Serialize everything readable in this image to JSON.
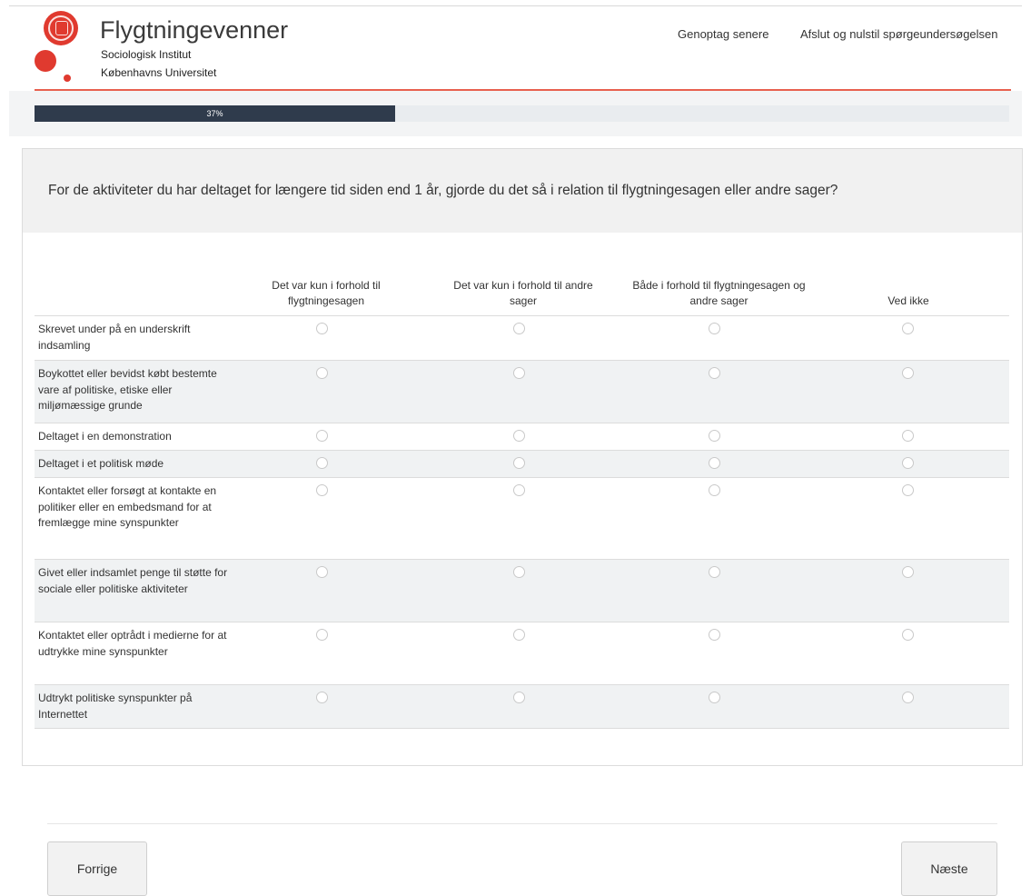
{
  "header": {
    "brand": "Flygtningevenner",
    "institute": "Sociologisk Institut",
    "university": "Københavns Universitet",
    "resume_link": "Genoptag senere",
    "exit_link": "Afslut og nulstil spørgeundersøgelsen"
  },
  "progress": {
    "value": 0.37,
    "label": "37%"
  },
  "question": {
    "text": "For de aktiviteter du har deltaget for længere tid siden end 1 år, gjorde du det så i relation til flygtningesagen eller andre sager?",
    "columns": [
      "Det var kun i forhold til flygtningesagen",
      "Det var kun i forhold til andre sager",
      "Både i forhold til flygtningesagen og andre sager",
      "Ved ikke"
    ],
    "rows": [
      "Skrevet under på en underskrift indsamling",
      "Boykottet eller bevidst købt bestemte vare af politiske, etiske eller miljømæssige grunde",
      "Deltaget i en demonstration",
      "Deltaget i et politisk møde",
      "Kontaktet eller forsøgt at kontakte en politiker eller en embedsmand for at fremlægge mine synspunkter",
      "Givet eller indsamlet penge til støtte for sociale eller politiske aktiviteter",
      "Kontaktet eller optrådt i medierne for at udtrykke mine synspunkter",
      "Udtrykt politiske synspunkter på Internettet"
    ]
  },
  "nav": {
    "prev_label": "Forrige",
    "next_label": "Næste"
  },
  "colors": {
    "accent": "#e03a2f",
    "rule": "#e8604f",
    "progress_fill": "#2f3b4c",
    "row_alt": "#f0f2f3"
  }
}
